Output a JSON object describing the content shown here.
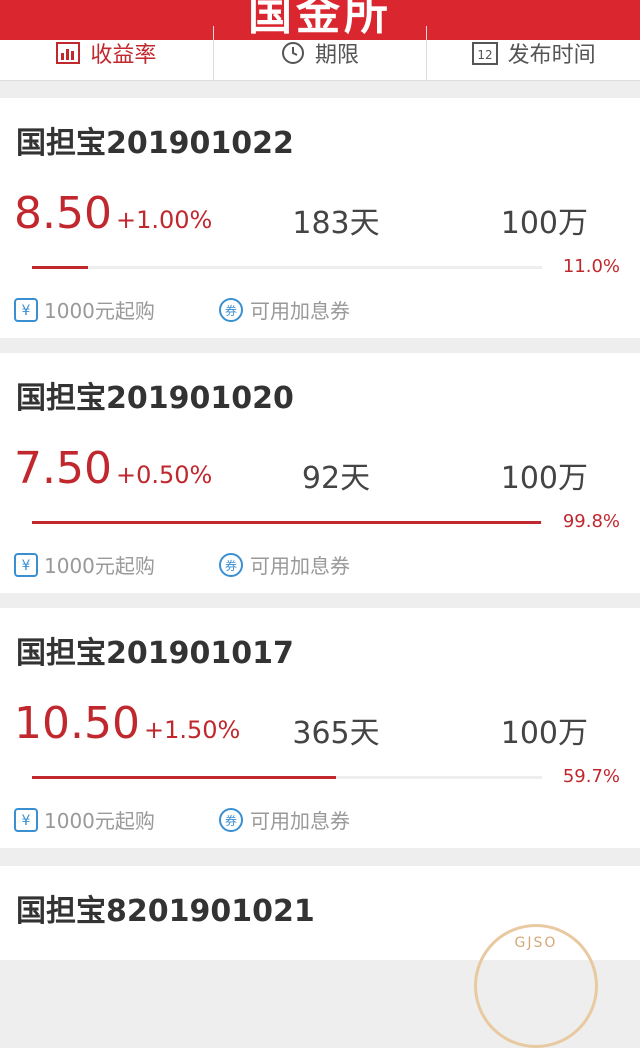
{
  "header": {
    "title": "国金所"
  },
  "tabs": [
    {
      "label": "收益率",
      "icon": "bar-chart-icon"
    },
    {
      "label": "期限",
      "icon": "clock-icon"
    },
    {
      "label": "发布时间",
      "icon": "calendar-icon"
    }
  ],
  "colors": {
    "brand": "#d9262f",
    "accent": "#c0282e",
    "blue": "#3a8fd1"
  },
  "products": [
    {
      "name": "国担宝201901022",
      "rate": "8.50",
      "bonus": "+1.00%",
      "term": "183天",
      "amount": "100万",
      "progress_pct": 11.0,
      "progress_label": "11.0%",
      "min_label": "1000元起购",
      "coupon_label": "可用加息券"
    },
    {
      "name": "国担宝201901020",
      "rate": "7.50",
      "bonus": "+0.50%",
      "term": "92天",
      "amount": "100万",
      "progress_pct": 99.8,
      "progress_label": "99.8%",
      "min_label": "1000元起购",
      "coupon_label": "可用加息券"
    },
    {
      "name": "国担宝201901017",
      "rate": "10.50",
      "bonus": "+1.50%",
      "term": "365天",
      "amount": "100万",
      "progress_pct": 59.7,
      "progress_label": "59.7%",
      "min_label": "1000元起购",
      "coupon_label": "可用加息券"
    },
    {
      "name": "国担宝8201901021"
    }
  ],
  "seal": {
    "text": "GJSO"
  }
}
